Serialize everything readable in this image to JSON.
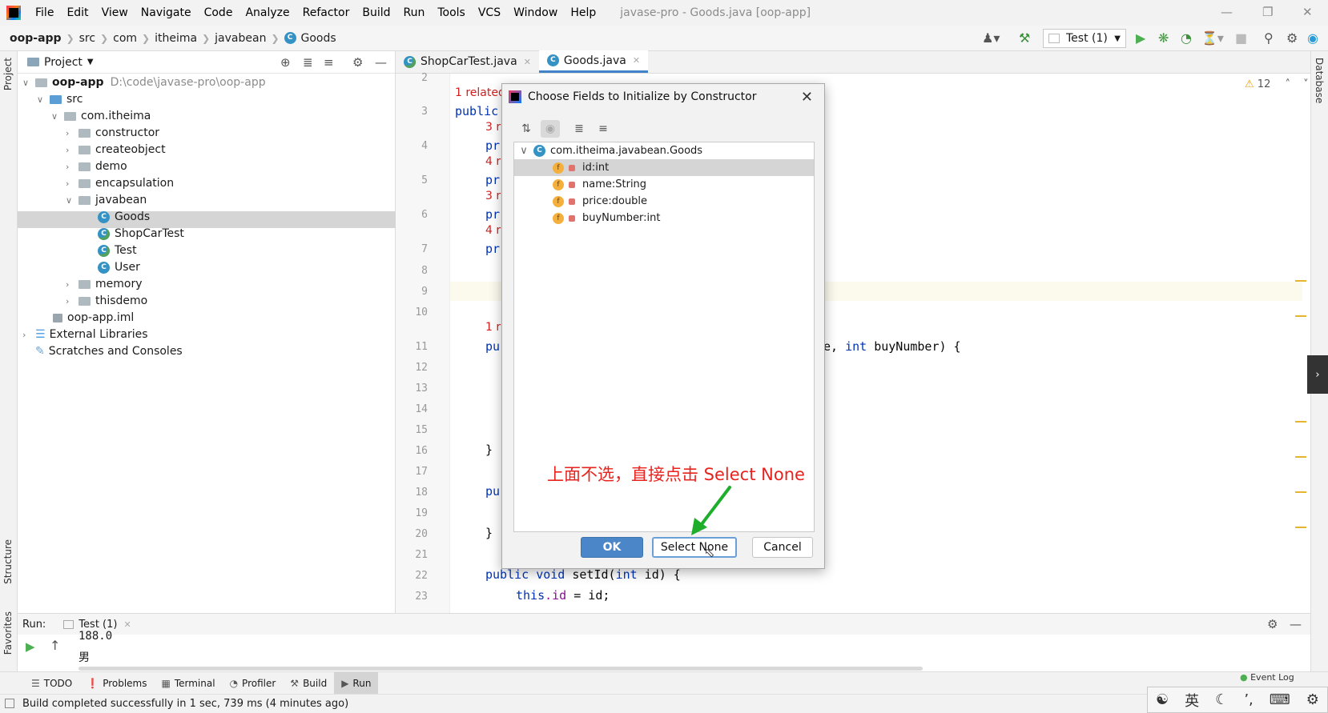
{
  "menubar": {
    "items": [
      "File",
      "Edit",
      "View",
      "Navigate",
      "Code",
      "Analyze",
      "Refactor",
      "Build",
      "Run",
      "Tools",
      "VCS",
      "Window",
      "Help"
    ],
    "window_title": "javase-pro - Goods.java [oop-app]"
  },
  "breadcrumb": [
    "oop-app",
    "src",
    "com",
    "itheima",
    "javabean",
    "Goods"
  ],
  "run_config": "Test (1)",
  "left_strip": {
    "project": "Project",
    "structure": "Structure",
    "favorites": "Favorites"
  },
  "right_strip": {
    "database": "Database"
  },
  "project_panel": {
    "title": "Project",
    "tree": [
      {
        "label": "oop-app",
        "hint": "D:\\code\\javase-pro\\oop-app"
      },
      {
        "label": "src"
      },
      {
        "label": "com.itheima"
      },
      {
        "label": "constructor"
      },
      {
        "label": "createobject"
      },
      {
        "label": "demo"
      },
      {
        "label": "encapsulation"
      },
      {
        "label": "javabean"
      },
      {
        "label": "Goods"
      },
      {
        "label": "ShopCarTest"
      },
      {
        "label": "Test"
      },
      {
        "label": "User"
      },
      {
        "label": "memory"
      },
      {
        "label": "thisdemo"
      },
      {
        "label": "oop-app.iml"
      },
      {
        "label": "External Libraries"
      },
      {
        "label": "Scratches and Consoles"
      }
    ]
  },
  "editor": {
    "tabs": [
      {
        "label": "ShopCarTest.java"
      },
      {
        "label": "Goods.java"
      }
    ],
    "warnings": "12",
    "line_numbers": [
      "2",
      "3",
      "4",
      "5",
      "6",
      "7",
      "8",
      "9",
      "10",
      "11",
      "12",
      "13",
      "14",
      "15",
      "16",
      "17",
      "18",
      "19",
      "20",
      "21",
      "22",
      "23"
    ],
    "hint_related": "1 related",
    "hints": [
      "3 r",
      "4 r",
      "3 r",
      "4 r",
      "1 r"
    ],
    "code": {
      "public": "public",
      "pr1": "pr",
      "pr2": "pr",
      "pr3": "pr",
      "pr4": "pr",
      "pu1": "pu",
      "ctor_tail_1": "e, ",
      "ctor_tail_kw": "int",
      "ctor_tail_2": " buyNumber) {",
      "brace1": "}",
      "pu2": "pu",
      "brace2": "}",
      "setid_kw1": "public",
      "setid_kw2": "void",
      "setid_name": " setId(",
      "setid_kw3": "int",
      "setid_rest": " id) {",
      "this_kw": "this",
      "this_fld": ".id",
      "this_rest": " = id;"
    }
  },
  "dialog": {
    "title": "Choose Fields to Initialize by Constructor",
    "root": "com.itheima.javabean.Goods",
    "fields": [
      "id:int",
      "name:String",
      "price:double",
      "buyNumber:int"
    ],
    "annotation": "上面不选，直接点击 Select None",
    "ok": "OK",
    "select_none": "Select None",
    "cancel": "Cancel"
  },
  "run_panel": {
    "label": "Run:",
    "tab": "Test (1)",
    "output": [
      "188.0",
      "男"
    ]
  },
  "bottom_tools": [
    "TODO",
    "Problems",
    "Terminal",
    "Profiler",
    "Build",
    "Run"
  ],
  "event_log": "Event Log",
  "status": "Build completed successfully in 1 sec, 739 ms (4 minutes ago)",
  "ime": {
    "lang": "英"
  },
  "colors": {
    "accent": "#4083c9",
    "annotation": "#e8231d",
    "arrow": "#1fae2c",
    "ok_button": "#4a86c8"
  }
}
